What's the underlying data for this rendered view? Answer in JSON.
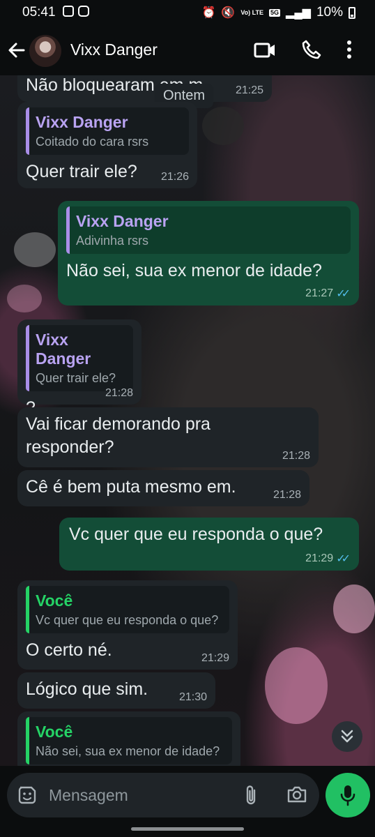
{
  "status_bar": {
    "time": "05:41",
    "network_top": "5G",
    "network_sub": "Vo) LTE",
    "battery": "10%",
    "icons": [
      "gallery-icon",
      "instagram-icon",
      "alarm-icon",
      "mute-icon",
      "signal-icon",
      "battery-icon"
    ]
  },
  "header": {
    "contact_name": "Vixx Danger",
    "icons": [
      "back-arrow-icon",
      "avatar",
      "video-call-icon",
      "phone-icon",
      "more-vert-icon"
    ]
  },
  "chat": {
    "date_chip": "Ontem",
    "partial_message": {
      "text": "Não bloquearam em m.",
      "time": "21:25"
    },
    "messages": [
      {
        "direction": "in",
        "quote_name": "Vixx Danger",
        "quote_text": "Coitado do cara rsrs",
        "text": "Quer trair ele?",
        "time": "21:26"
      },
      {
        "direction": "out",
        "quote_name": "Vixx Danger",
        "quote_text": "Adivinha rsrs",
        "text": "Não sei, sua ex menor de idade?",
        "time": "21:27"
      },
      {
        "direction": "in",
        "quote_name": "Vixx Danger",
        "quote_text": "Quer trair ele?",
        "text": "?",
        "time": "21:28"
      },
      {
        "direction": "in",
        "text": "Vai ficar demorando pra responder?",
        "time": "21:28"
      },
      {
        "direction": "in",
        "text": "Cê é bem puta mesmo em.",
        "time": "21:28"
      },
      {
        "direction": "out",
        "text": "Vc quer que eu responda o que?",
        "time": "21:29"
      },
      {
        "direction": "in",
        "quote_name": "Você",
        "quote_text": "Vc quer que eu responda o que?",
        "text": "O certo né.",
        "time": "21:29"
      },
      {
        "direction": "in",
        "text": "Lógico que sim.",
        "time": "21:30"
      },
      {
        "direction": "in",
        "quote_name": "Você",
        "quote_text": "Não sei, sua ex menor de idade?",
        "text": "",
        "time": ""
      }
    ],
    "read_receipt_color": "#53bdeb",
    "incoming_bubble_color": "#1f2428",
    "outgoing_bubble_color": "#134d37"
  },
  "composer": {
    "placeholder": "Mensagem",
    "icons": [
      "sticker-icon",
      "attach-icon",
      "camera-icon",
      "mic-icon"
    ],
    "mic_color": "#21c063"
  }
}
